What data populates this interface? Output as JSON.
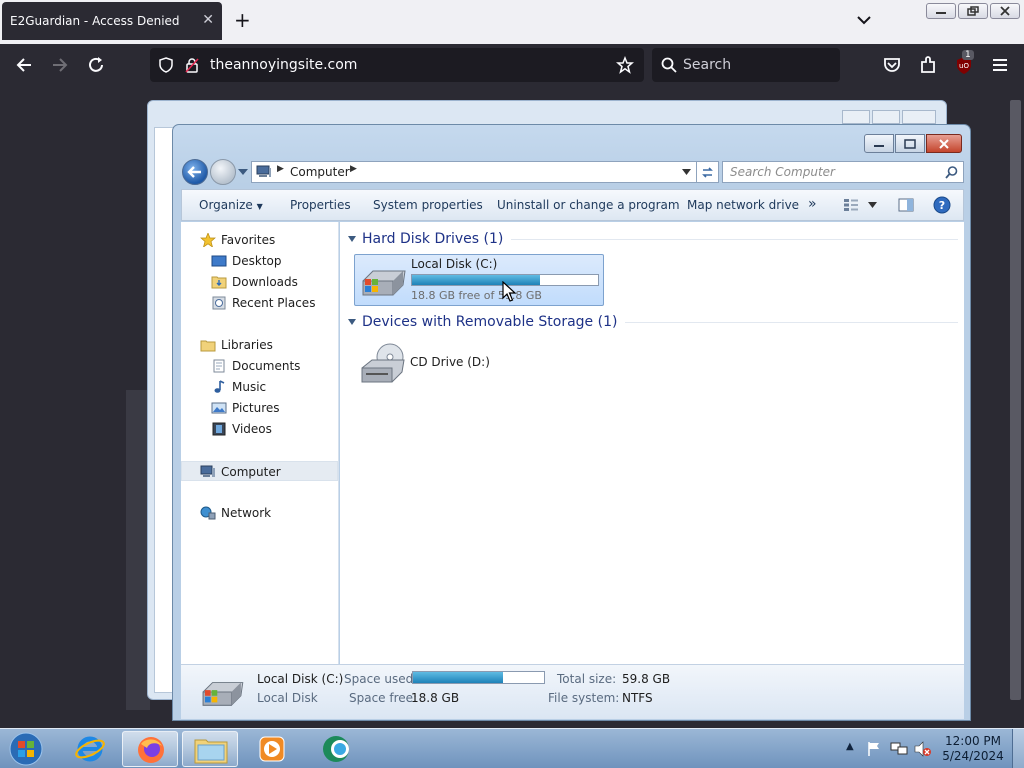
{
  "browser": {
    "tab_title": "E2Guardian - Access Denied",
    "url": "theannoyingsite.com",
    "search_placeholder": "Search",
    "extension_badge": "1"
  },
  "explorer": {
    "breadcrumb": "Computer",
    "search_placeholder": "Search Computer",
    "toolbar": {
      "organize": "Organize",
      "properties": "Properties",
      "system_properties": "System properties",
      "uninstall": "Uninstall or change a program",
      "map_drive": "Map network drive",
      "more": "»"
    },
    "nav": {
      "favorites": "Favorites",
      "desktop": "Desktop",
      "downloads": "Downloads",
      "recent_places": "Recent Places",
      "libraries": "Libraries",
      "documents": "Documents",
      "music": "Music",
      "pictures": "Pictures",
      "videos": "Videos",
      "computer": "Computer",
      "network": "Network"
    },
    "groups": {
      "hard_disk": "Hard Disk Drives (1)",
      "removable": "Devices with Removable Storage (1)"
    },
    "local_disk": {
      "name": "Local Disk (C:)",
      "free_text": "18.8 GB free of 59.8 GB",
      "used_fraction": 0.686
    },
    "cd_drive": {
      "name": "CD Drive (D:)"
    },
    "details": {
      "name": "Local Disk (C:)",
      "type": "Local Disk",
      "space_used_label": "Space used:",
      "space_free_label": "Space free:",
      "space_free": "18.8 GB",
      "total_size_label": "Total size:",
      "total_size": "59.8 GB",
      "file_system_label": "File system:",
      "file_system": "NTFS"
    }
  },
  "taskbar": {
    "time": "12:00 PM",
    "date": "5/24/2024"
  },
  "colors": {
    "firefox_dark": "#2b2a33",
    "explorer_frame": "#b9cfe6",
    "selection": "#c1dcfc",
    "progress": "#1e82b8",
    "group_header": "#1e3287"
  }
}
